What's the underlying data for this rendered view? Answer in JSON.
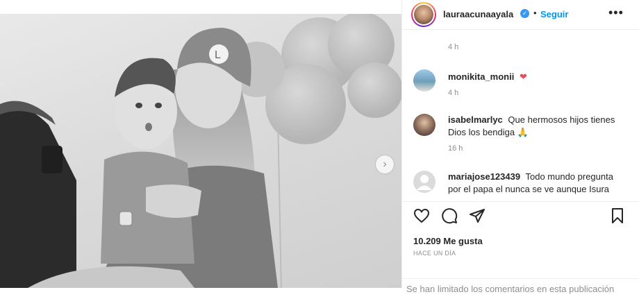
{
  "post": {
    "username": "lauraacunaayala",
    "follow_label": "Seguir",
    "likes_text": "10.209 Me gusta",
    "posted_ago": "HACE UN DÍA",
    "limited_comments_notice": "Se han limitado los comentarios en esta publicación"
  },
  "comments": [
    {
      "username": "",
      "text": "",
      "time": "4 h"
    },
    {
      "username": "monikita_monii",
      "text": "",
      "time": "4 h",
      "emoji": "❤"
    },
    {
      "username": "isabelmarlyc",
      "text": "Que hermosos hijos tienes Dios los bendiga 🙏",
      "time": "16 h"
    },
    {
      "username": "mariajose123439",
      "text": "Todo mundo pregunta por el papa el nunca se ve aunque Isura"
    }
  ],
  "icons": {
    "next": "chevron-right-icon",
    "more": "more-options-icon",
    "like": "heart-icon",
    "comment": "comment-icon",
    "share": "share-icon",
    "save": "bookmark-icon",
    "verified": "verified-badge-icon"
  },
  "colors": {
    "accent": "#0095f6",
    "verified": "#3897f0",
    "heart": "#ed4956",
    "muted": "#8e8e8e",
    "text": "#262626"
  }
}
